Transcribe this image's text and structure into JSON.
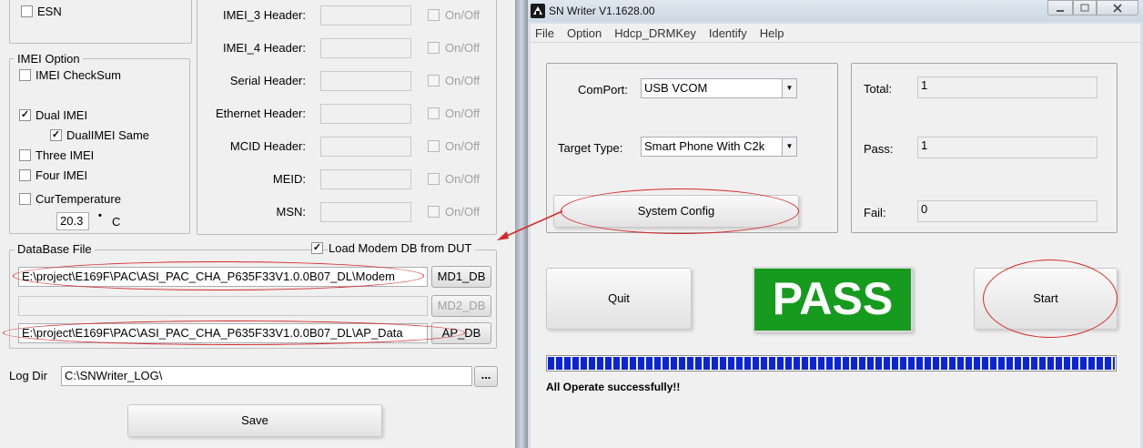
{
  "left": {
    "esn_label": "ESN",
    "imei_option": {
      "title": "IMEI Option",
      "imei_checksum": "IMEI CheckSum",
      "dual_imei": "Dual IMEI",
      "dual_imei_same": "DualIMEI Same",
      "three_imei": "Three IMEI",
      "four_imei": "Four IMEI",
      "cur_temperature": "CurTemperature",
      "temperature_value": "20.3",
      "temperature_unit": "C"
    },
    "headers": [
      {
        "label": "IMEI_3 Header:",
        "toggle": "On/Off"
      },
      {
        "label": "IMEI_4 Header:",
        "toggle": "On/Off"
      },
      {
        "label": "Serial Header:",
        "toggle": "On/Off"
      },
      {
        "label": "Ethernet Header:",
        "toggle": "On/Off"
      },
      {
        "label": "MCID Header:",
        "toggle": "On/Off"
      },
      {
        "label": "MEID:",
        "toggle": "On/Off"
      },
      {
        "label": "MSN:",
        "toggle": "On/Off"
      }
    ],
    "database": {
      "title": "DataBase File",
      "load_modem_label": "Load Modem DB from DUT",
      "md1_path": "E:\\project\\E169F\\PAC\\ASI_PAC_CHA_P635F33V1.0.0B07_DL\\Modem",
      "md1_button": "MD1_DB",
      "md2_path": "",
      "md2_button": "MD2_DB",
      "ap_path": "E:\\project\\E169F\\PAC\\ASI_PAC_CHA_P635F33V1.0.0B07_DL\\AP_Data",
      "ap_button": "AP_DB"
    },
    "log_dir_label": "Log Dir",
    "log_dir_value": "C:\\SNWriter_LOG\\",
    "browse_button": "...",
    "save_button": "Save"
  },
  "right": {
    "window_title": "SN Writer V1.1628.00",
    "menu": [
      "File",
      "Option",
      "Hdcp_DRMKey",
      "Identify",
      "Help"
    ],
    "comport_label": "ComPort:",
    "comport_value": "USB VCOM",
    "target_type_label": "Target Type:",
    "target_type_value": "Smart Phone With C2k",
    "system_config_button": "System Config",
    "total_label": "Total:",
    "total_value": "1",
    "pass_label": "Pass:",
    "pass_value": "1",
    "fail_label": "Fail:",
    "fail_value": "0",
    "quit_button": "Quit",
    "status_banner": "PASS",
    "start_button": "Start",
    "progress": 1.0,
    "status_message": "All Operate successfully!!"
  },
  "colors": {
    "pass_green": "#169b1e",
    "progress_blue": "#0b24d6",
    "annotation_red": "#d42a2a"
  }
}
